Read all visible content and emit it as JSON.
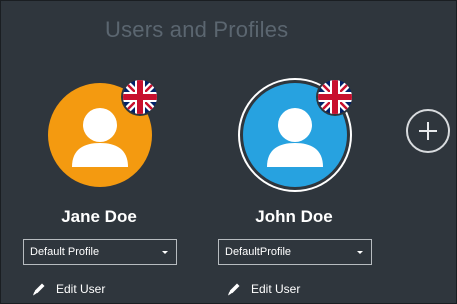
{
  "page": {
    "title": "Users and Profiles"
  },
  "users": [
    {
      "name": "Jane Doe",
      "profile": "Default Profile",
      "edit_label": "Edit User",
      "avatar_color": "#f49a10",
      "flag": "uk-flag-icon"
    },
    {
      "name": "John Doe",
      "profile": "DefaultProfile",
      "edit_label": "Edit User",
      "avatar_color": "#27a2e0",
      "flag": "uk-flag-icon"
    }
  ],
  "actions": {
    "add_icon": "plus-icon"
  },
  "colors": {
    "background": "#2f363d",
    "title_text": "#5b6670",
    "name_text": "#ffffff"
  }
}
